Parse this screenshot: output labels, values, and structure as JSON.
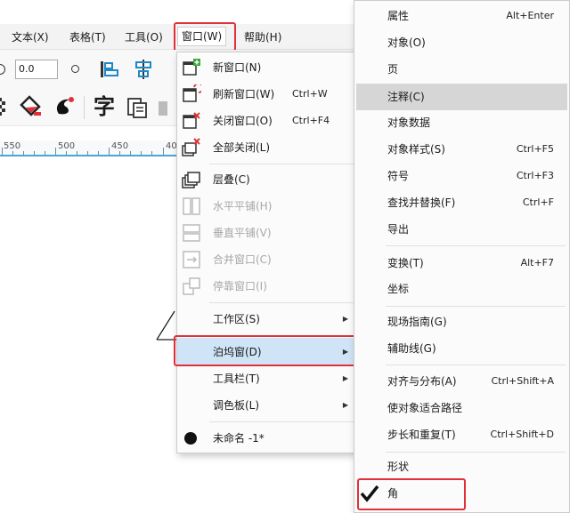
{
  "menubar": {
    "items": [
      {
        "label": "文本(X)"
      },
      {
        "label": "表格(T)"
      },
      {
        "label": "工具(O)"
      },
      {
        "label": "窗口(W)"
      },
      {
        "label": "帮助(H)"
      }
    ]
  },
  "toolbar": {
    "value_field": "0.0",
    "text_tool_glyph": "字"
  },
  "ruler": {
    "labels": [
      "550",
      "500",
      "450",
      "40"
    ]
  },
  "window_menu": {
    "items": [
      {
        "label": "新窗口(N)",
        "shortcut": "",
        "icon": "new-window-icon"
      },
      {
        "label": "刷新窗口(W)",
        "shortcut": "Ctrl+W",
        "icon": "refresh-window-icon"
      },
      {
        "label": "关闭窗口(O)",
        "shortcut": "Ctrl+F4",
        "icon": "close-window-icon"
      },
      {
        "label": "全部关闭(L)",
        "shortcut": "",
        "icon": "close-all-icon"
      },
      {
        "label": "层叠(C)",
        "shortcut": "",
        "icon": "cascade-icon"
      },
      {
        "label": "水平平铺(H)",
        "shortcut": "",
        "icon": "tile-horizontal-icon"
      },
      {
        "label": "垂直平铺(V)",
        "shortcut": "",
        "icon": "tile-vertical-icon"
      },
      {
        "label": "合并窗口(C)",
        "shortcut": "",
        "icon": "combine-windows-icon"
      },
      {
        "label": "停靠窗口(I)",
        "shortcut": "",
        "icon": "dock-windows-icon"
      },
      {
        "label": "工作区(S)",
        "shortcut": ""
      },
      {
        "label": "泊坞窗(D)",
        "shortcut": ""
      },
      {
        "label": "工具栏(T)",
        "shortcut": ""
      },
      {
        "label": "调色板(L)",
        "shortcut": ""
      },
      {
        "label": "未命名 -1*",
        "shortcut": "",
        "icon": "document-dot-icon"
      }
    ]
  },
  "docker_menu": {
    "items": [
      {
        "label": "属性",
        "shortcut": "Alt+Enter"
      },
      {
        "label": "对象(O)",
        "shortcut": ""
      },
      {
        "label": "页",
        "shortcut": ""
      },
      {
        "label": "注释(C)",
        "shortcut": ""
      },
      {
        "label": "对象数据",
        "shortcut": ""
      },
      {
        "label": "对象样式(S)",
        "shortcut": "Ctrl+F5"
      },
      {
        "label": "符号",
        "shortcut": "Ctrl+F3"
      },
      {
        "label": "查找并替换(F)",
        "shortcut": "Ctrl+F"
      },
      {
        "label": "导出",
        "shortcut": ""
      },
      {
        "label": "变换(T)",
        "shortcut": "Alt+F7"
      },
      {
        "label": "坐标",
        "shortcut": ""
      },
      {
        "label": "现场指南(G)",
        "shortcut": ""
      },
      {
        "label": "辅助线(G)",
        "shortcut": ""
      },
      {
        "label": "对齐与分布(A)",
        "shortcut": "Ctrl+Shift+A"
      },
      {
        "label": "使对象适合路径",
        "shortcut": ""
      },
      {
        "label": "步长和重复(T)",
        "shortcut": "Ctrl+Shift+D"
      },
      {
        "label": "形状",
        "shortcut": ""
      },
      {
        "label": "角",
        "shortcut": ""
      }
    ]
  },
  "colors": {
    "highlight_box": "#e0313a",
    "accent_blue": "#4aa6d8",
    "disabled_text": "#a7a7a7"
  }
}
